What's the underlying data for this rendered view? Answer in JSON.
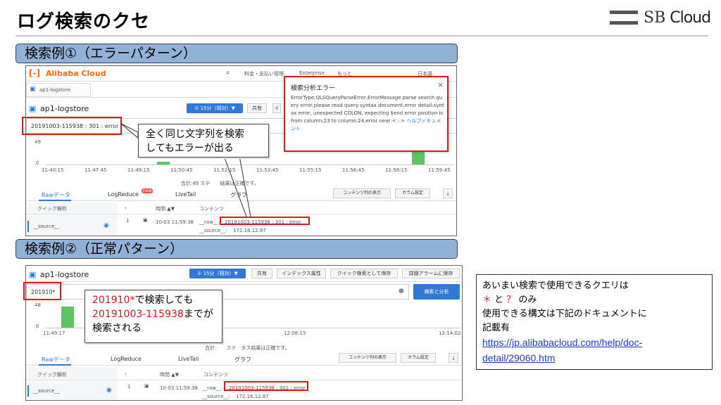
{
  "title": "ログ検索のクセ",
  "logo": {
    "brand": "SB",
    "product": "Cloud"
  },
  "section1": {
    "label": "検索例①（エラーパターン）"
  },
  "section2": {
    "label": "検索例②（正常パターン）"
  },
  "shot1": {
    "header_brand": "Alibaba Cloud",
    "header_menu": [
      "料金・支払い管理",
      "Enterprise",
      "もっと",
      "",
      "日本語"
    ],
    "breadcrumb": "ap1-logstore",
    "logstore_name": "ap1-logstore",
    "time_button": "① 15分（相対）▼",
    "share_button": "共有",
    "query": "20191003-115938 : 301 : error",
    "y_labels": [
      "49",
      "0"
    ],
    "x_labels": [
      "11:40:15",
      "11:47:45",
      "11:49:15",
      "11:50:45",
      "11:52:15",
      "11:53:45",
      "11:55:15",
      "11:56:45",
      "11:58:15",
      "11:59:45"
    ],
    "hits_text": "合計:49 ステ　　結果は正確です。",
    "tabs": [
      "Rawデータ",
      "LogReduce",
      "LiveTail",
      "グラフ"
    ],
    "new_badge": "new",
    "buttons": [
      "コンテンツ列の表示",
      "カラム設定"
    ],
    "table_headers": [
      "クイック解析",
      "時間 ▲▼",
      "コンテンツ"
    ],
    "row": {
      "field": "__source__",
      "num": "1",
      "time": "10-03 11:59:38",
      "raw_key": "__raw__:",
      "raw_val": "20191003-115938 : 301 : error",
      "source_key": "__source__:",
      "source_val": "172.16.12.87"
    },
    "error_dialog": {
      "title": "検索分析エラー",
      "close": "×",
      "body": "ErrorType:QLSQueryParseError,ErrorMessage:parse search query error,please read query syntax document,error detail:syntax error, unexpected COLON, expecting $end error position is from column:23 to column:24,error near < : >",
      "link": "ヘルプドキュメント"
    }
  },
  "callout1": {
    "line1": "全く同じ文字列を検索",
    "line2": "してもエラーが出る"
  },
  "shot2": {
    "logstore_name": "ap1-logstore",
    "time_button": "① 15分（相対）▼",
    "toolbar": [
      "共有",
      "インデックス属性",
      "クイック検索として保存",
      "詳細アラームに保存"
    ],
    "query": "201910*",
    "search_button": "検索と分析",
    "y_labels": [
      "48",
      "0"
    ],
    "x_labels": [
      "11:49:17",
      "12:08:15",
      "12:14:02"
    ],
    "hits_text": "合計:　　ステ　タス結果は正確です。",
    "tabs": [
      "Rawデータ",
      "LogReduce",
      "LiveTail",
      "グラフ"
    ],
    "buttons": [
      "コンテンツ列の表示",
      "カラム設定"
    ],
    "table_headers": [
      "クイック解析",
      "時間 ▲▼",
      "コンテンツ"
    ],
    "row": {
      "field": "__source__",
      "num": "1",
      "time": "10-03 11:59:38",
      "raw_key": "__raw__:",
      "raw_val": "20191003-115938",
      "raw_rest": " : 301 : error",
      "source_key": "__source__:",
      "source_val": "172.16.12.87"
    }
  },
  "callout2": {
    "q": "201910*",
    "l1_rest": "で検索しても",
    "id": "20191003-115938",
    "l2_rest": "までが",
    "line3": "検索される"
  },
  "note": {
    "line1": "あいまい検索で使用できるクエリは",
    "sym1": "＊",
    "and": " と ",
    "sym2": "？",
    "only": " のみ",
    "line3": "使用できる構文は下記のドキュメントに",
    "line4": "記載有",
    "link": "https://jp.alibabacloud.com/help/doc-detail/29060.htm"
  },
  "colors": {
    "accent_bar": "#8fb2d6",
    "red": "#e01818",
    "blue_button": "#2f78d8",
    "chart_green": "#5cc461"
  }
}
